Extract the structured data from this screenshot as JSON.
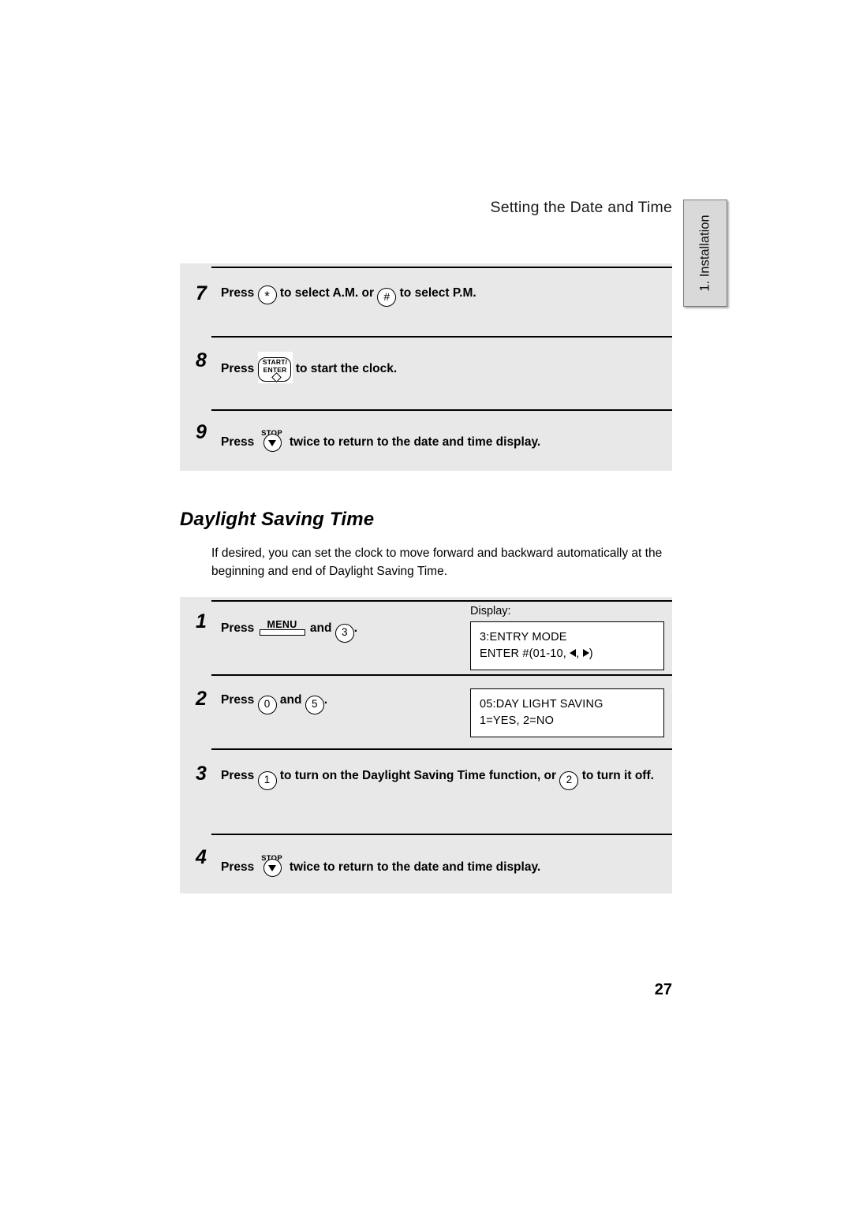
{
  "header": {
    "title": "Setting the Date and Time",
    "tab_label": "1. Installation"
  },
  "top_steps": [
    {
      "num": "7",
      "press_label": "Press",
      "key1": "*",
      "mid_text": "to select A.M. or",
      "key2": "#",
      "end_text": "to select P.M."
    },
    {
      "num": "8",
      "press_label": "Press",
      "key_line1": "START/",
      "key_line2": "ENTER",
      "end_text": "to start the clock."
    },
    {
      "num": "9",
      "press_label": "Press",
      "key_label": "STOP",
      "end_text": "twice to return to the date and time display."
    }
  ],
  "section": {
    "heading": "Daylight Saving Time",
    "paragraph": "If desired, you can set the clock to move forward and backward automatically at the beginning and end of Daylight Saving Time."
  },
  "display_label": "Display:",
  "bottom_steps": [
    {
      "num": "1",
      "press_label": "Press",
      "key_menu": "MENU",
      "and_text": "and",
      "key_digit": "3",
      "period": ".",
      "display_line1": "3:ENTRY MODE",
      "display_line2_pre": "ENTER #(01-10,",
      "display_line2_comma": ",",
      "display_line2_post": ")"
    },
    {
      "num": "2",
      "press_label": "Press",
      "key_digit1": "0",
      "and_text": "and",
      "key_digit2": "5",
      "period": ".",
      "display_line1": "05:DAY LIGHT SAVING",
      "display_line2": "1=YES, 2=NO"
    },
    {
      "num": "3",
      "press_label": "Press",
      "key_digit1": "1",
      "mid_text": "to turn on the Daylight Saving Time function, or",
      "key_digit2": "2",
      "end_text": "to turn it",
      "end_text2": "off."
    },
    {
      "num": "4",
      "press_label": "Press",
      "key_label": "STOP",
      "end_text": "twice to return to the date and time display."
    }
  ],
  "footer": {
    "page_number": "27"
  }
}
